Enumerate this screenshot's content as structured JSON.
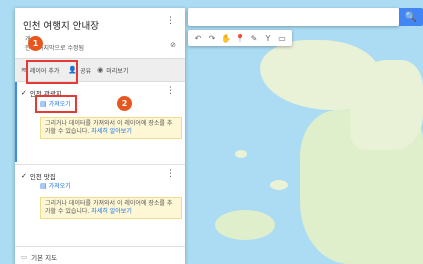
{
  "search": {
    "button_icon": "search-icon",
    "glyph": "🔍"
  },
  "toolbar": {
    "tools": [
      "↶",
      "↷",
      "✋",
      "📍",
      "✎",
      "Y",
      "▭"
    ]
  },
  "panel": {
    "title": "인천 여행지 안내장",
    "kebab": "⋮",
    "subtitle_line1": "개",
    "subtitle_line2": "전에 마지막으로 수정됨",
    "share_icon_glyph": "⊘",
    "actions": {
      "add_layer": "레이어 추가",
      "share": "공유",
      "preview": "미리보기"
    }
  },
  "layers": [
    {
      "name": "인천 관광지",
      "checked": "✓",
      "import_label": "가져오기",
      "note_text": "그리거나 데이터를 가져와서 이 레이어에 장소를 추가할 수 있습니다.",
      "note_link": "자세히 알아보기"
    },
    {
      "name": "인천 맛집",
      "checked": "✓",
      "import_label": "가져오기",
      "note_text": "그리거나 데이터를 가져와서 이 레이어에 장소를 추가할 수 있습니다.",
      "note_link": "자세히 알아보기"
    }
  ],
  "basemap": {
    "label": "기본 지도",
    "arrow": "▭"
  },
  "callouts": {
    "one": "1",
    "two": "2"
  },
  "colors": {
    "accent": "#4285f4",
    "highlight": "#e53935",
    "badge": "#e8561f",
    "note_bg": "#fef7d6"
  }
}
